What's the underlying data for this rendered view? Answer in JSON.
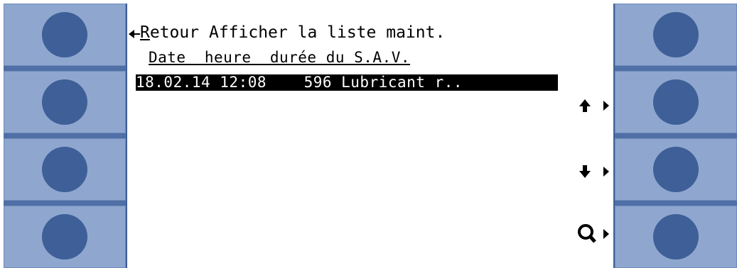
{
  "screen": {
    "back_label_first": "R",
    "back_label_rest": "etour",
    "title": "Afficher la liste maint."
  },
  "table": {
    "header": "Date  heure  durée du S.A.V.",
    "rows": [
      "18.02.14 12:08    596 Lubricant r.."
    ]
  },
  "softkeys": {
    "up": "arrow-up-icon",
    "down": "arrow-down-icon",
    "search": "search-icon"
  },
  "colors": {
    "panel": "#8fa7cf",
    "knob": "#3e5f97",
    "highlight": "#000000"
  }
}
